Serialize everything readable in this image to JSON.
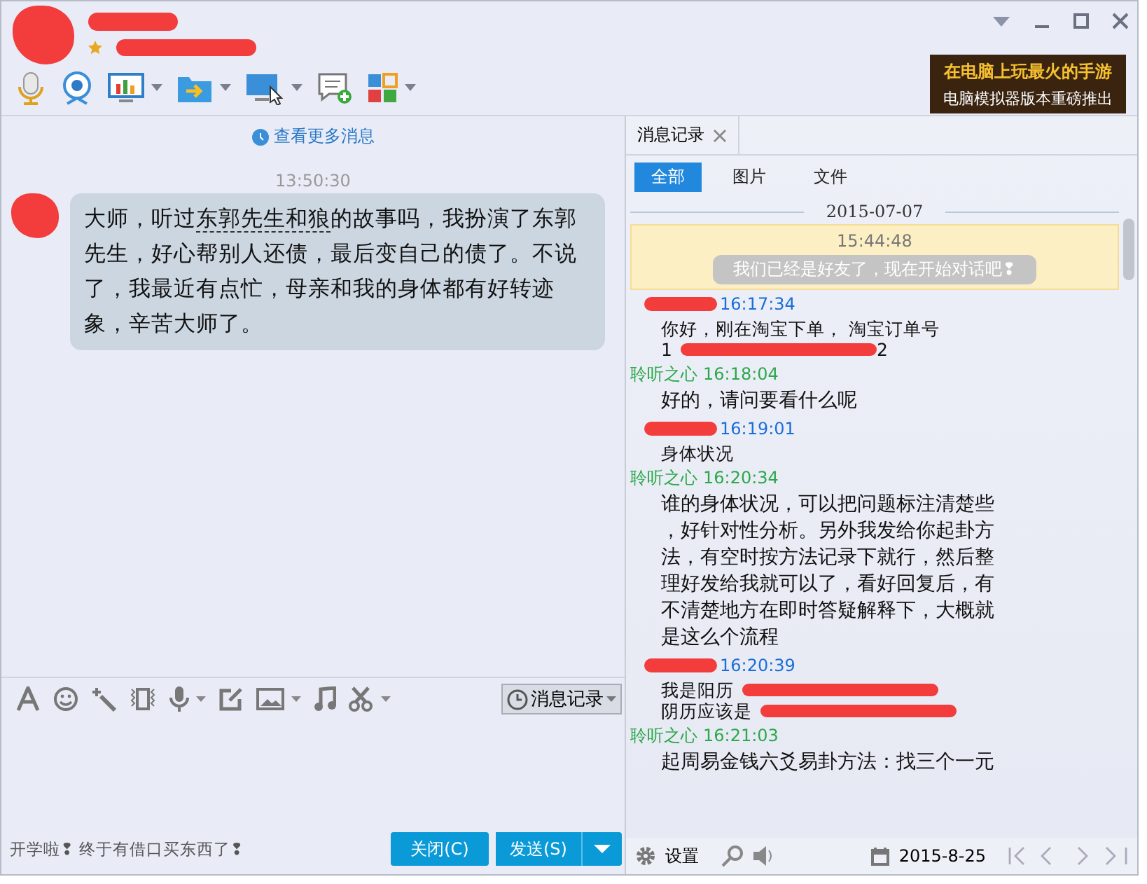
{
  "toolbar": {
    "items": [
      {
        "kind": "mic",
        "caret": false
      },
      {
        "kind": "camera",
        "caret": false
      },
      {
        "kind": "screen-chart",
        "caret": true
      },
      {
        "kind": "folder",
        "caret": true
      },
      {
        "kind": "screen-share",
        "caret": true
      },
      {
        "kind": "chat-add",
        "caret": false
      },
      {
        "kind": "apps",
        "caret": true
      }
    ]
  },
  "ad": {
    "line_1": "在电脑上玩最火的手游",
    "line_2": "电脑模拟器版本重磅推出"
  },
  "chat": {
    "more_link": "查看更多消息",
    "time": "13:50:30",
    "message": [
      {
        "kind": "text",
        "text": "大师，听过"
      },
      {
        "kind": "link",
        "text": "东郭先生和狼"
      },
      {
        "kind": "text",
        "text": "的故事吗，我扮演了东郭先生，好心帮别人还债，最后变自己的债了。不说了，我最近有点忙，母亲和我的身体都有好转迹象，辛苦大师了。"
      }
    ]
  },
  "input_toolbar": {
    "items": [
      {
        "kind": "font",
        "caret": false
      },
      {
        "kind": "smile",
        "caret": false
      },
      {
        "kind": "wand",
        "caret": false
      },
      {
        "kind": "shake",
        "caret": false
      },
      {
        "kind": "mic",
        "caret": true
      },
      {
        "kind": "edit",
        "caret": false
      },
      {
        "kind": "image",
        "caret": true
      },
      {
        "kind": "music",
        "caret": false
      },
      {
        "kind": "scissors",
        "caret": true
      }
    ],
    "history_button": "消息记录"
  },
  "signature": "开学啦❢ 终于有借口买东西了❢",
  "buttons": {
    "close": "关闭(C)",
    "send": "发送(S)"
  },
  "history": {
    "tab": "消息记录",
    "filters": [
      {
        "label": "全部",
        "selected": true
      },
      {
        "label": "图片",
        "selected": false
      },
      {
        "label": "文件",
        "selected": false
      }
    ],
    "date": "2015-07-07",
    "system": {
      "time": "15:44:48",
      "text": "我们已经是好友了，现在开始对话吧❢"
    },
    "messages": [
      {
        "kind": "them",
        "time": "16:17:34",
        "lines": [
          [
            {
              "kind": "text",
              "text": "你好，刚在淘宝下单，  淘宝订单号"
            }
          ],
          [
            {
              "kind": "text",
              "text": "1"
            },
            {
              "kind": "redaction"
            },
            {
              "kind": "text",
              "text": "2"
            }
          ]
        ]
      },
      {
        "kind": "me",
        "sender": "聆听之心",
        "time": "16:18:04",
        "lines": [
          [
            {
              "kind": "text",
              "text": "好的，请问要看什么呢"
            }
          ]
        ]
      },
      {
        "kind": "them",
        "time": "16:19:01",
        "lines": [
          [
            {
              "kind": "text",
              "text": "身体状况"
            }
          ]
        ]
      },
      {
        "kind": "me",
        "sender": "聆听之心",
        "time": "16:20:34",
        "lines": [
          [
            {
              "kind": "text",
              "text": "谁的身体状况，可以把问题标注清楚些"
            }
          ],
          [
            {
              "kind": "text",
              "text": "，好针对性分析。另外我发给你起卦方"
            }
          ],
          [
            {
              "kind": "text",
              "text": "法，有空时按方法记录下就行，然后整"
            }
          ],
          [
            {
              "kind": "text",
              "text": "理好发给我就可以了，看好回复后，有"
            }
          ],
          [
            {
              "kind": "text",
              "text": "不清楚地方在即时答疑解释下，大概就"
            }
          ],
          [
            {
              "kind": "text",
              "text": "是这么个流程"
            }
          ]
        ]
      },
      {
        "kind": "them",
        "time": "16:20:39",
        "lines": [
          [
            {
              "kind": "text",
              "text": "我是阳历"
            },
            {
              "kind": "redaction"
            }
          ],
          [
            {
              "kind": "text",
              "text": "阴历应该是"
            },
            {
              "kind": "redaction"
            }
          ]
        ]
      },
      {
        "kind": "me",
        "sender": "聆听之心",
        "time": "16:21:03",
        "lines": [
          [
            {
              "kind": "text",
              "text": "起周易金钱六爻易卦方法：找三个一元"
            }
          ]
        ]
      }
    ],
    "footer": {
      "settings": "设置",
      "date": "2015-8-25"
    }
  }
}
